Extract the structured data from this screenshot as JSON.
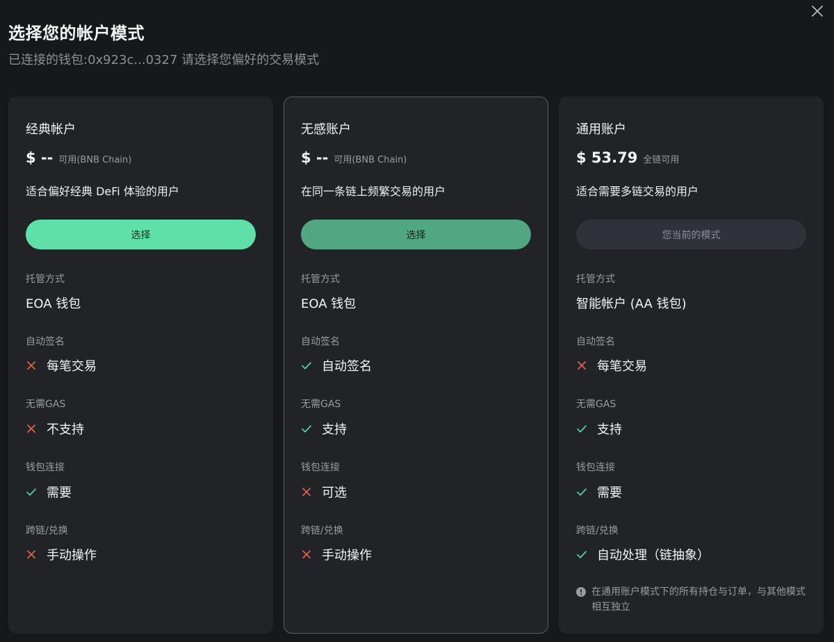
{
  "modal": {
    "title": "选择您的帐户模式",
    "subtitle": "已连接的钱包:0x923c...0327 请选择您偏好的交易模式"
  },
  "cards": [
    {
      "name": "经典帐户",
      "amount": "$ --",
      "availability": "可用(BNB Chain)",
      "description": "适合偏好经典 DeFi 体验的用户",
      "button": "选择",
      "features": [
        {
          "label": "托管方式",
          "value": "EOA 钱包",
          "icon": "none"
        },
        {
          "label": "自动签名",
          "value": "每笔交易",
          "icon": "cross-icon"
        },
        {
          "label": "无需GAS",
          "value": "不支持",
          "icon": "cross-icon"
        },
        {
          "label": "钱包连接",
          "value": "需要",
          "icon": "check-icon"
        },
        {
          "label": "跨链/兑换",
          "value": "手动操作",
          "icon": "cross-icon"
        }
      ]
    },
    {
      "name": "无感账户",
      "amount": "$ --",
      "availability": "可用(BNB Chain)",
      "description": "在同一条链上频繁交易的用户",
      "button": "选择",
      "features": [
        {
          "label": "托管方式",
          "value": "EOA 钱包",
          "icon": "none"
        },
        {
          "label": "自动签名",
          "value": "自动签名",
          "icon": "check-icon"
        },
        {
          "label": "无需GAS",
          "value": "支持",
          "icon": "check-icon"
        },
        {
          "label": "钱包连接",
          "value": "可选",
          "icon": "cross-icon"
        },
        {
          "label": "跨链/兑换",
          "value": "手动操作",
          "icon": "cross-icon"
        }
      ]
    },
    {
      "name": "通用账户",
      "amount": "$ 53.79",
      "availability": "全链可用",
      "description": "适合需要多链交易的用户",
      "button": "您当前的模式",
      "features": [
        {
          "label": "托管方式",
          "value": "智能帐户 (AA 钱包)",
          "icon": "none"
        },
        {
          "label": "自动签名",
          "value": "每笔交易",
          "icon": "cross-icon"
        },
        {
          "label": "无需GAS",
          "value": "支持",
          "icon": "check-icon"
        },
        {
          "label": "钱包连接",
          "value": "需要",
          "icon": "check-icon"
        },
        {
          "label": "跨链/兑换",
          "value": "自动处理（链抽象）",
          "icon": "check-icon"
        }
      ],
      "note": "在通用账户模式下的所有持仓与订单，与其他模式相互独立"
    }
  ],
  "colors": {
    "background": "#17181b",
    "card": "#222327",
    "accent": "#5ee0a8",
    "check": "#4fd39a",
    "cross": "#e0604f"
  }
}
